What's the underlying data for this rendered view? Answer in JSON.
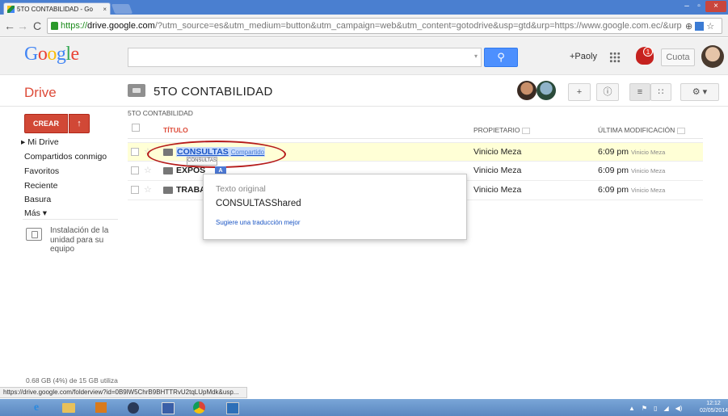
{
  "browser": {
    "tab_title": "5TO CONTABILIDAD - Go",
    "tab_close": "×",
    "url_scheme": "https://",
    "url_host": "drive.google.com",
    "url_rest": "/?utm_source=es&utm_medium=button&utm_campaign=web&utm_content=gotodrive&usp=gtd&urp=https://www.google.com.ec/&urp",
    "back": "←",
    "forward": "→",
    "reload": "C",
    "win_min": "–",
    "win_max": "▫",
    "win_close": "×",
    "zoom_icon": "⊕",
    "star_icon": "☆"
  },
  "googlebar": {
    "logo": "Google",
    "search_value": "",
    "search_icon": "⚲",
    "plus_user": "+Paoly",
    "notification_count": "1",
    "cuota": "Cuota"
  },
  "drive": {
    "title": "Drive",
    "folder_title": "5TO CONTABILIDAD",
    "share_btn": "+",
    "info_btn": "ⓘ",
    "list_view": "≡",
    "grid_view": "∷",
    "settings": "⚙ ▾"
  },
  "sidebar": {
    "create": "CREAR",
    "upload_icon": "↑",
    "items": [
      "▸ Mi Drive",
      "Compartidos conmigo",
      "Favoritos",
      "Reciente",
      "Basura",
      "Más ▾"
    ],
    "install_text": "Instalación de la unidad para su equipo",
    "quota_text": "0.68 GB (4%) de 15 GB utiliza"
  },
  "list": {
    "breadcrumb": "5TO CONTABILIDAD",
    "headers": {
      "title": "TÍTULO",
      "owner": "PROPIETARIO",
      "modified": "ÚLTIMA MODIFICACIÓN"
    },
    "rows": [
      {
        "name": "CONSULTAS",
        "badge": "Compartido",
        "owner": "Vinicio Meza",
        "time": "6:09 pm",
        "by": "Vinicio Meza"
      },
      {
        "name": "EXPOS",
        "badge": "",
        "owner": "Vinicio Meza",
        "time": "6:09 pm",
        "by": "Vinicio Meza"
      },
      {
        "name": "TRABA",
        "badge": "",
        "owner": "Vinicio Meza",
        "time": "6:09 pm",
        "by": "Vinicio Meza"
      }
    ]
  },
  "translate": {
    "tooltip": "CONSULTAS",
    "icon": "A",
    "caption": "Texto original",
    "original": "CONSULTASShared",
    "suggest": "Sugiere una traducción mejor"
  },
  "statusbar": {
    "url": "https://drive.google.com/folderview?id=0B9lW5ChrB9BHTTRvU2tqLUpMdk&usp..."
  },
  "taskbar": {
    "ie": "e",
    "clock_time": "12:12",
    "clock_date": "02/05/2014"
  },
  "colors": {
    "accent_red": "#dd4b39",
    "search_blue": "#4d90fe",
    "selected_row": "#ffffd6",
    "annotation": "#b51a1a"
  }
}
